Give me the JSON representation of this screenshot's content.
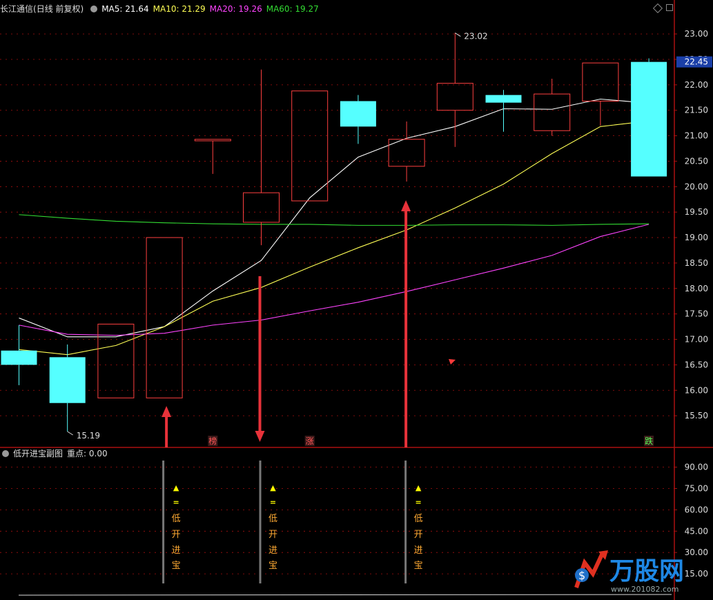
{
  "main_header": {
    "stock_name": "长江通信",
    "period": "(日线 前复权)",
    "ma5": "MA5: 21.64",
    "ma10": "MA10: 21.29",
    "ma20": "MA20: 19.26",
    "ma60": "MA60: 19.27"
  },
  "sub_header": {
    "title": "低开进宝副图",
    "focus": "重点: 0.00"
  },
  "colors": {
    "up": "#ff4040",
    "down": "#55ffff",
    "ma5": "#ffffff",
    "ma10": "#ffff55",
    "ma20": "#ff44ff",
    "ma60": "#33dd33",
    "grid": "#aa1111",
    "axis_text": "#dddddd"
  },
  "chart_data": [
    {
      "type": "candlestick",
      "ylim": [
        15.0,
        23.3
      ],
      "y_ticks": [
        "15.50",
        "16.00",
        "16.50",
        "17.00",
        "17.50",
        "18.00",
        "18.50",
        "19.00",
        "19.50",
        "20.00",
        "20.50",
        "21.00",
        "21.50",
        "22.00",
        "22.50",
        "23.00"
      ],
      "current_price": "22.45",
      "candles": [
        {
          "open": 16.78,
          "close": 16.5,
          "high": 17.28,
          "low": 16.1
        },
        {
          "open": 16.65,
          "close": 15.75,
          "high": 16.9,
          "low": 15.19
        },
        {
          "open": 15.85,
          "close": 17.3,
          "high": 17.3,
          "low": 15.85
        },
        {
          "open": 15.85,
          "close": 19.0,
          "high": 19.0,
          "low": 15.85
        },
        {
          "open": 20.9,
          "close": 20.93,
          "high": 20.93,
          "low": 20.25
        },
        {
          "open": 19.3,
          "close": 19.88,
          "high": 22.3,
          "low": 18.85
        },
        {
          "open": 19.72,
          "close": 21.88,
          "high": 21.88,
          "low": 19.72
        },
        {
          "open": 21.68,
          "close": 21.18,
          "high": 21.8,
          "low": 20.84
        },
        {
          "open": 20.4,
          "close": 20.93,
          "high": 21.28,
          "low": 20.1
        },
        {
          "open": 21.5,
          "close": 22.03,
          "high": 23.02,
          "low": 20.78
        },
        {
          "open": 21.8,
          "close": 21.65,
          "high": 21.9,
          "low": 21.08
        },
        {
          "open": 21.1,
          "close": 21.82,
          "high": 22.12,
          "low": 21.0
        },
        {
          "open": 21.68,
          "close": 22.43,
          "high": 22.43,
          "low": 21.2
        },
        {
          "open": 22.45,
          "close": 20.2,
          "high": 22.52,
          "low": 20.2
        }
      ],
      "series": [
        {
          "name": "MA5",
          "values": [
            17.42,
            17.05,
            17.05,
            17.25,
            17.95,
            18.55,
            19.78,
            20.58,
            20.95,
            21.18,
            21.53,
            21.52,
            21.72,
            21.64
          ]
        },
        {
          "name": "MA10",
          "values": [
            16.8,
            16.7,
            16.88,
            17.25,
            17.75,
            18.02,
            18.42,
            18.8,
            19.15,
            19.58,
            20.05,
            20.65,
            21.18,
            21.29
          ]
        },
        {
          "name": "MA20",
          "values": [
            17.28,
            17.1,
            17.08,
            17.12,
            17.28,
            17.38,
            17.56,
            17.73,
            17.94,
            18.17,
            18.4,
            18.65,
            19.02,
            19.26
          ]
        },
        {
          "name": "MA60",
          "values": [
            19.45,
            19.38,
            19.32,
            19.29,
            19.27,
            19.26,
            19.26,
            19.24,
            19.24,
            19.25,
            19.25,
            19.24,
            19.26,
            19.27
          ]
        }
      ],
      "annotations": {
        "high_label": "23.02",
        "low_label": "15.19",
        "tags": [
          {
            "bar": 4,
            "text": "榜",
            "color": "#ff5555"
          },
          {
            "bar": 6,
            "text": "涨",
            "color": "#ff5555"
          },
          {
            "bar": 13,
            "text": "跌",
            "color": "#55ff55"
          }
        ],
        "arrows": [
          {
            "bar": 3,
            "direction": "up"
          },
          {
            "bar": 5,
            "direction": "down"
          },
          {
            "bar": 8,
            "direction": "up"
          }
        ]
      }
    },
    {
      "type": "bar",
      "title": "低开进宝副图",
      "ylim": [
        0,
        100
      ],
      "y_ticks": [
        "15.00",
        "30.00",
        "45.00",
        "60.00",
        "75.00",
        "90.00"
      ],
      "signals": [
        {
          "bar": 3,
          "chars": [
            "▲",
            "=",
            "低",
            "开",
            "进",
            "宝"
          ]
        },
        {
          "bar": 5,
          "chars": [
            "▲",
            "=",
            "低",
            "开",
            "进",
            "宝"
          ]
        },
        {
          "bar": 8,
          "chars": [
            "▲",
            "=",
            "低",
            "开",
            "进",
            "宝"
          ]
        }
      ]
    }
  ],
  "watermark": {
    "brand": "万股网",
    "site": "www.201082.com"
  }
}
